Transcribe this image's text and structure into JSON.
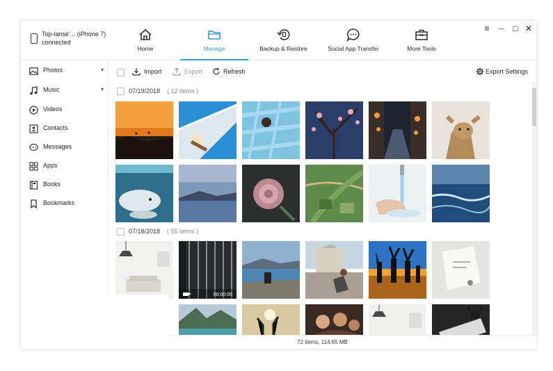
{
  "device": {
    "name": "Top-lanse'... (iPhone 7)",
    "status": "connected"
  },
  "nav": [
    {
      "label": "Home",
      "icon": "home-icon"
    },
    {
      "label": "Manage",
      "icon": "folder-icon",
      "active": true
    },
    {
      "label": "Backup & Restore",
      "icon": "backup-restore-icon"
    },
    {
      "label": "Social App Transfer",
      "icon": "chat-bubble-icon"
    },
    {
      "label": "More Tools",
      "icon": "toolbox-icon"
    }
  ],
  "window_controls": {
    "menu": "≡",
    "minimize": "—",
    "maximize": "□",
    "close": "✕"
  },
  "sidebar": [
    {
      "label": "Photos",
      "icon": "image-icon",
      "expand": "▾"
    },
    {
      "label": "Music",
      "icon": "music-note-icon",
      "expand": "▾"
    },
    {
      "label": "Videos",
      "icon": "play-circle-icon"
    },
    {
      "label": "Contacts",
      "icon": "contact-card-icon"
    },
    {
      "label": "Messages",
      "icon": "message-icon"
    },
    {
      "label": "Apps",
      "icon": "apps-grid-icon"
    },
    {
      "label": "Books",
      "icon": "book-icon"
    },
    {
      "label": "Bookmarks",
      "icon": "bookmark-icon"
    }
  ],
  "toolbar": {
    "import": "Import",
    "export": "Export",
    "refresh": "Refresh",
    "export_settings": "Export Settings"
  },
  "groups": [
    {
      "date": "07/19/2018",
      "count": "( 12 items )"
    },
    {
      "date": "07/18/2018",
      "count": "( 55 items )"
    }
  ],
  "video": {
    "duration": "00:00:05"
  },
  "status": "72 items, 114.65 MB",
  "colors": {
    "accent": "#2e9fd8"
  }
}
